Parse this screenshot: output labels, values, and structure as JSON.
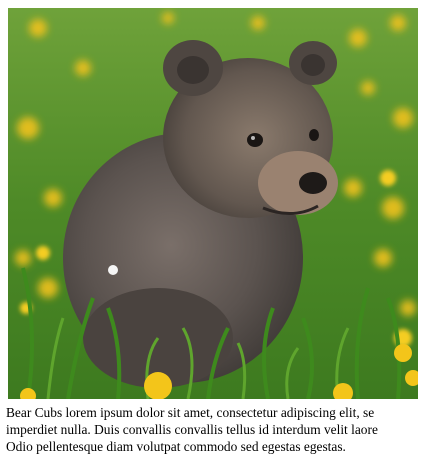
{
  "photo": {
    "subject": "bear-cub-photo",
    "colors": {
      "grass": "#4f8f2a",
      "flower": "#f2c419",
      "fur": "#5e5550"
    }
  },
  "caption": {
    "lines": [
      "Bear Cubs lorem ipsum dolor sit amet, consectetur adipiscing elit, se",
      "imperdiet nulla. Duis convallis convallis tellus id interdum velit laore",
      "Odio pellentesque diam volutpat commodo sed egestas egestas."
    ]
  }
}
